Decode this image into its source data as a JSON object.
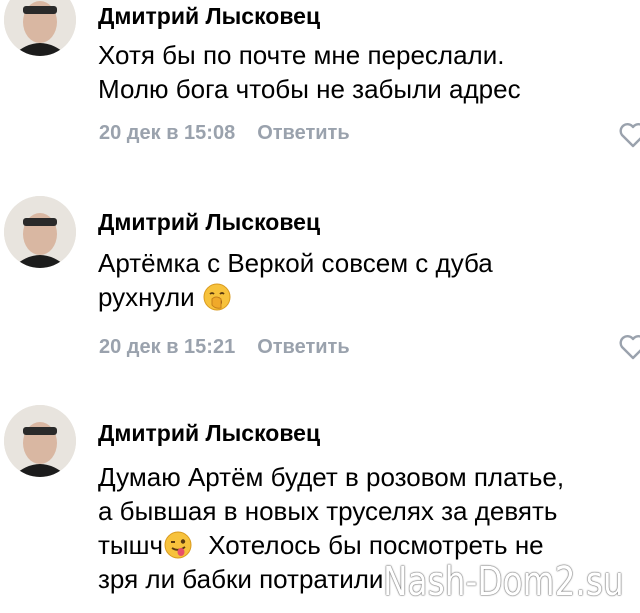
{
  "comments": [
    {
      "author": "Дмитрий Лысковец",
      "lines": [
        "Хотя бы по почте мне переслали.",
        "Молю бога чтобы не забыли адрес"
      ],
      "date": "20 дек в 15:08",
      "reply": "Ответить"
    },
    {
      "author": "Дмитрий Лысковец",
      "lines": [
        "Артёмка с Веркой совсем с дуба",
        "рухнули"
      ],
      "emoji": "yawning-face-emoji",
      "date": "20 дек в 15:21",
      "reply": "Ответить"
    },
    {
      "author": "Дмитрий Лысковец",
      "lines": [
        "Думаю Артём будет в розовом платье,",
        "а бывшая в новых труселях за девять",
        "тышч",
        "Хотелось бы посмотреть не",
        "зря ли бабки потратили"
      ],
      "emoji": "winking-tongue-emoji"
    }
  ],
  "watermark": "Nash-Dom2.su",
  "colors": {
    "meta": "#9aa2ad",
    "text": "#000000"
  }
}
